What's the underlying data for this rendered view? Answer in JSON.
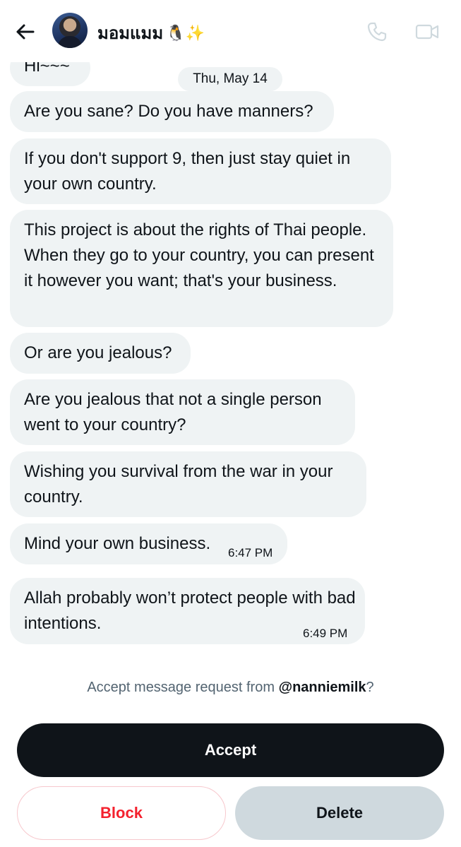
{
  "header": {
    "contact_name": "มอมแมม",
    "name_emojis": "🐧✨"
  },
  "conversation": {
    "date_separator": "Thu, May 14",
    "messages": [
      {
        "text": "Hi~~~"
      },
      {
        "text": "Are you sane? Do you have manners?"
      },
      {
        "text": "If you don't support 9, then just stay quiet in your own country."
      },
      {
        "text": "This project is about the rights of Thai people. When they go to your country, you can present it however you want; that's your business."
      },
      {
        "text": "Or are you jealous?"
      },
      {
        "text": "Are you jealous that not a single person went to your country?"
      },
      {
        "text": "Wishing you survival from the war in your country."
      },
      {
        "text": "Mind your own business.",
        "time": "6:47 PM"
      },
      {
        "text": "Allah probably won’t protect people with bad intentions.",
        "time": "6:49 PM"
      }
    ]
  },
  "request": {
    "prefix": "Accept message request from ",
    "handle": "@nanniemilk",
    "suffix": "?"
  },
  "actions": {
    "accept_label": "Accept",
    "block_label": "Block",
    "delete_label": "Delete"
  },
  "colors": {
    "bubble_bg": "#eff3f4",
    "accept_bg": "#0f1419",
    "block_text": "#f4212e",
    "delete_bg": "#cfd9de",
    "muted_text": "#536471"
  },
  "icons": {
    "back": "arrow-left-icon",
    "call": "phone-icon",
    "video": "video-camera-icon"
  }
}
